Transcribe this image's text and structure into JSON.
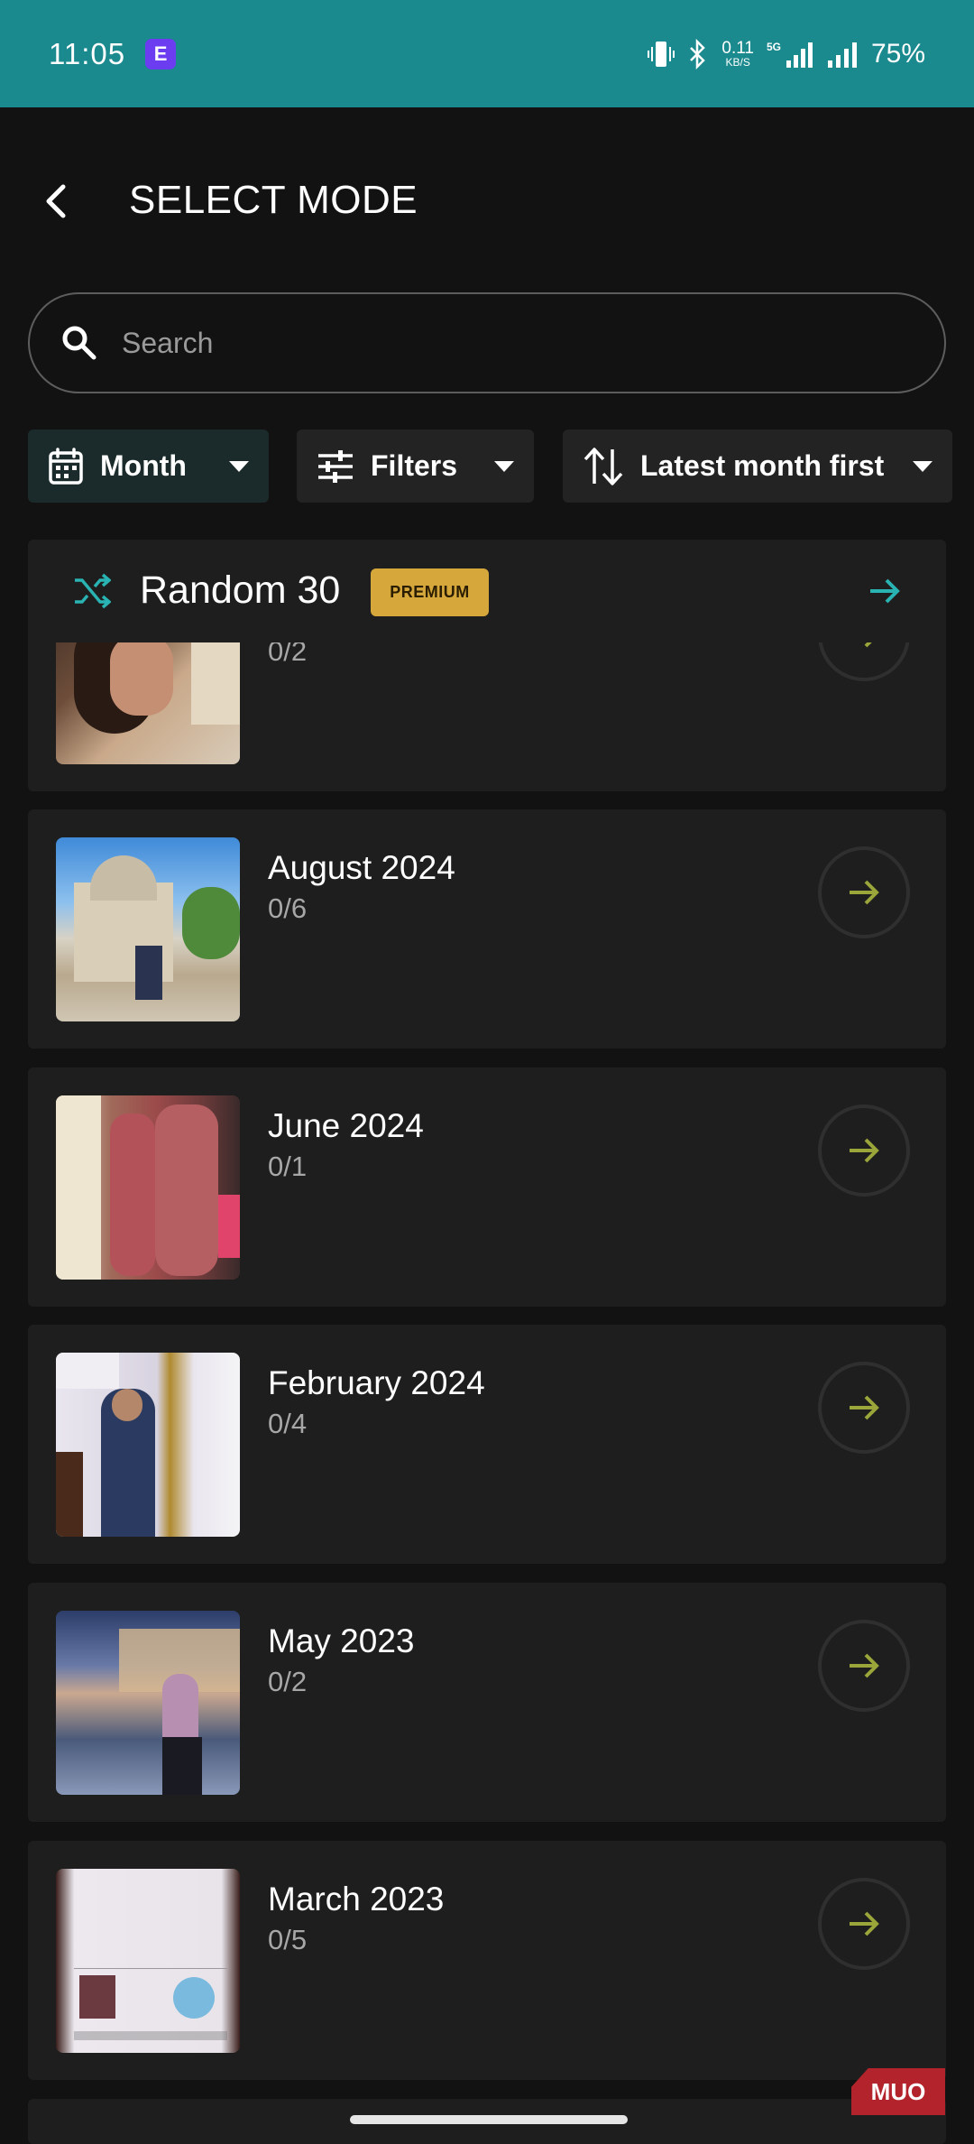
{
  "status_bar": {
    "time": "11:05",
    "app_icon_letter": "E",
    "net_speed_value": "0.11",
    "net_speed_unit": "KB/S",
    "network_type": "5G",
    "battery": "75%"
  },
  "header": {
    "title": "SELECT MODE"
  },
  "search": {
    "placeholder": "Search"
  },
  "chips": {
    "group_by": "Month",
    "filters": "Filters",
    "sort": "Latest month first"
  },
  "random": {
    "title": "Random 30",
    "badge": "PREMIUM"
  },
  "months": [
    {
      "title": "",
      "count": "0/2",
      "thumb": "partial-top"
    },
    {
      "title": "August 2024",
      "count": "0/6",
      "thumb": "monument"
    },
    {
      "title": "June 2024",
      "count": "0/1",
      "thumb": "couple"
    },
    {
      "title": "February 2024",
      "count": "0/4",
      "thumb": "speaker"
    },
    {
      "title": "May 2023",
      "count": "0/2",
      "thumb": "night"
    },
    {
      "title": "March 2023",
      "count": "0/5",
      "thumb": "passport"
    }
  ],
  "watermark": "MUO",
  "colors": {
    "status_bar": "#1b8a8f",
    "accent_teal": "#2ab3b3",
    "arrow_olive": "#9aa53a",
    "premium_gold": "#d6a83c"
  }
}
